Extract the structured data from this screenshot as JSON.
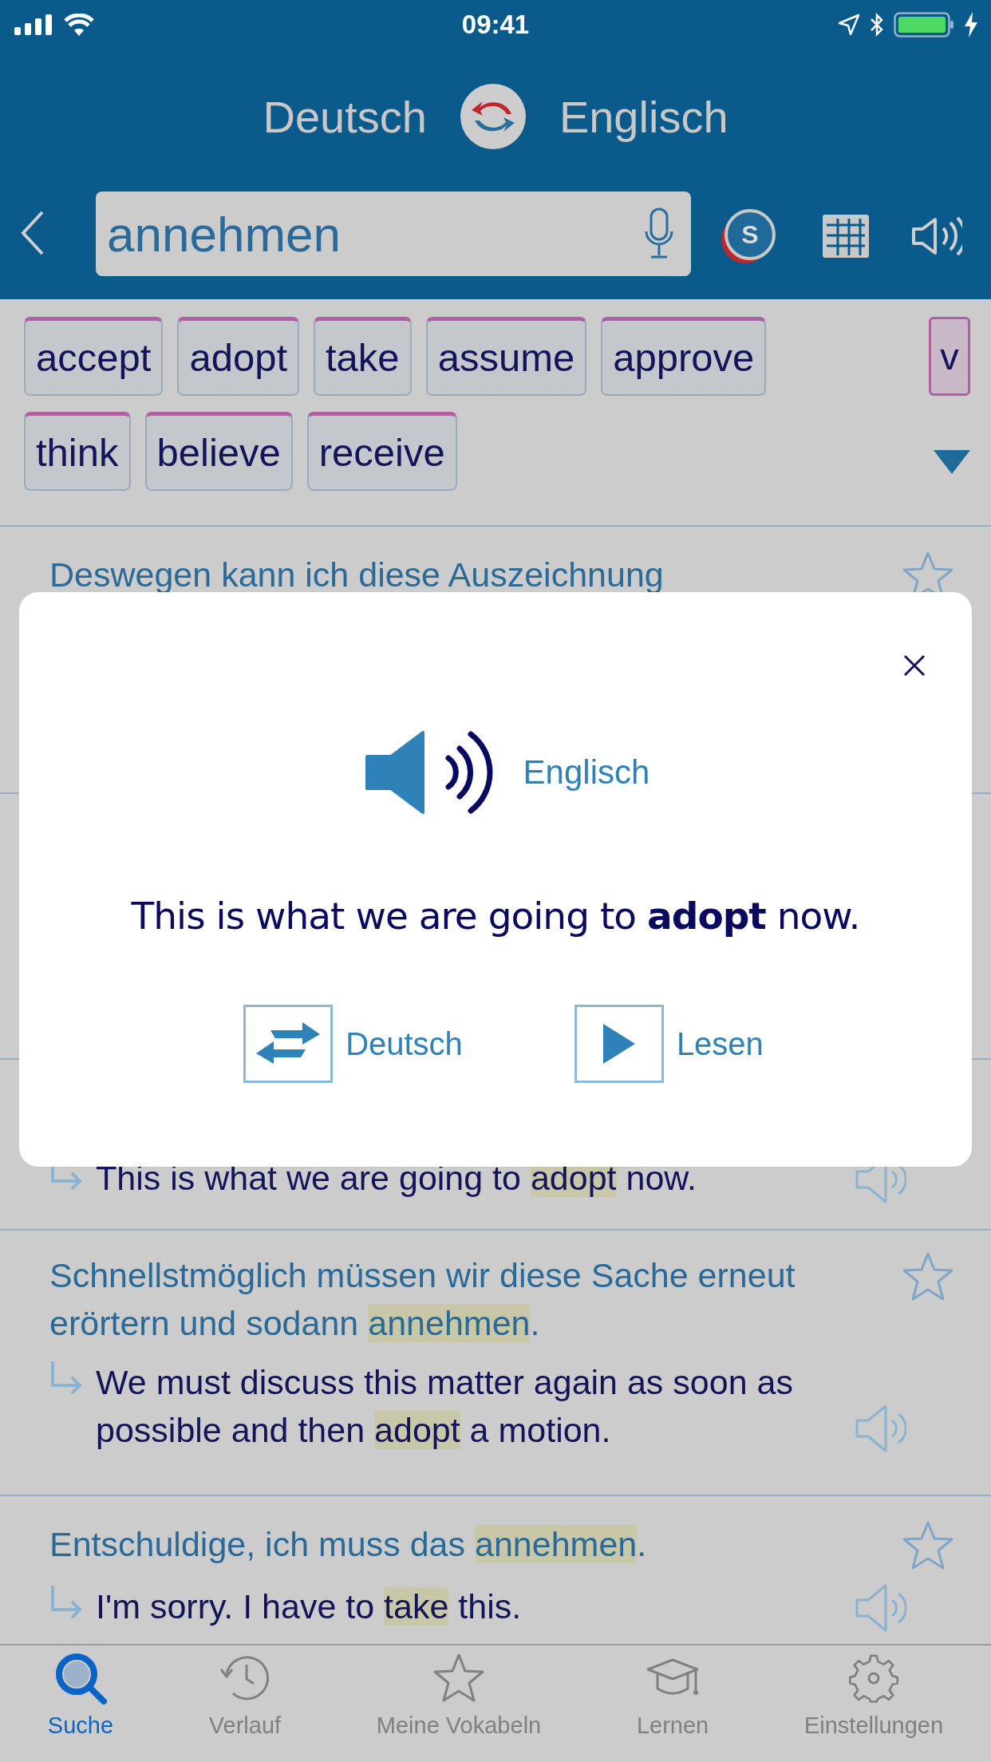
{
  "status_bar": {
    "time": "09:41"
  },
  "languages": {
    "source": "Deutsch",
    "target": "Englisch"
  },
  "search": {
    "value": "annehmen",
    "circle_button": "S"
  },
  "translations": [
    "accept",
    "adopt",
    "take",
    "assume",
    "approve",
    "think",
    "believe",
    "receive"
  ],
  "word_class": "v",
  "results": [
    {
      "german": [
        {
          "text": "Deswegen kann ich diese Auszeichnung",
          "highlighted": false
        }
      ]
    },
    {
      "english": [
        {
          "text": "This is what we are going to ",
          "highlighted": false
        },
        {
          "text": "adopt",
          "highlighted": true
        },
        {
          "text": " now.",
          "highlighted": false
        }
      ]
    },
    {
      "german": [
        {
          "text": "Schnellstmöglich müssen wir diese Sache erneut erörtern und sodann ",
          "highlighted": false
        },
        {
          "text": "annehmen",
          "highlighted": true
        },
        {
          "text": ".",
          "highlighted": false
        }
      ],
      "english": [
        {
          "text": "We must discuss this matter again as soon as possible and then ",
          "highlighted": false
        },
        {
          "text": "adopt",
          "highlighted": true
        },
        {
          "text": " a motion.",
          "highlighted": false
        }
      ]
    },
    {
      "german": [
        {
          "text": "Entschuldige, ich muss das ",
          "highlighted": false
        },
        {
          "text": "annehmen",
          "highlighted": true
        },
        {
          "text": ".",
          "highlighted": false
        }
      ],
      "english": [
        {
          "text": "I'm sorry. I have to ",
          "highlighted": false
        },
        {
          "text": "take",
          "highlighted": true
        },
        {
          "text": " this.",
          "highlighted": false
        }
      ]
    }
  ],
  "dialog": {
    "language": "Englisch",
    "sentence": "This is what we are going to **adopt** now.",
    "actions": [
      {
        "kind": "swap",
        "label": "Deutsch"
      },
      {
        "kind": "play",
        "label": "Lesen"
      }
    ]
  },
  "tabs": [
    {
      "label": "Suche",
      "selected": true
    },
    {
      "label": "Verlauf",
      "selected": false
    },
    {
      "label": "Meine Vokabeln",
      "selected": false
    },
    {
      "label": "Lernen",
      "selected": false
    },
    {
      "label": "Einstellungen",
      "selected": false
    }
  ]
}
